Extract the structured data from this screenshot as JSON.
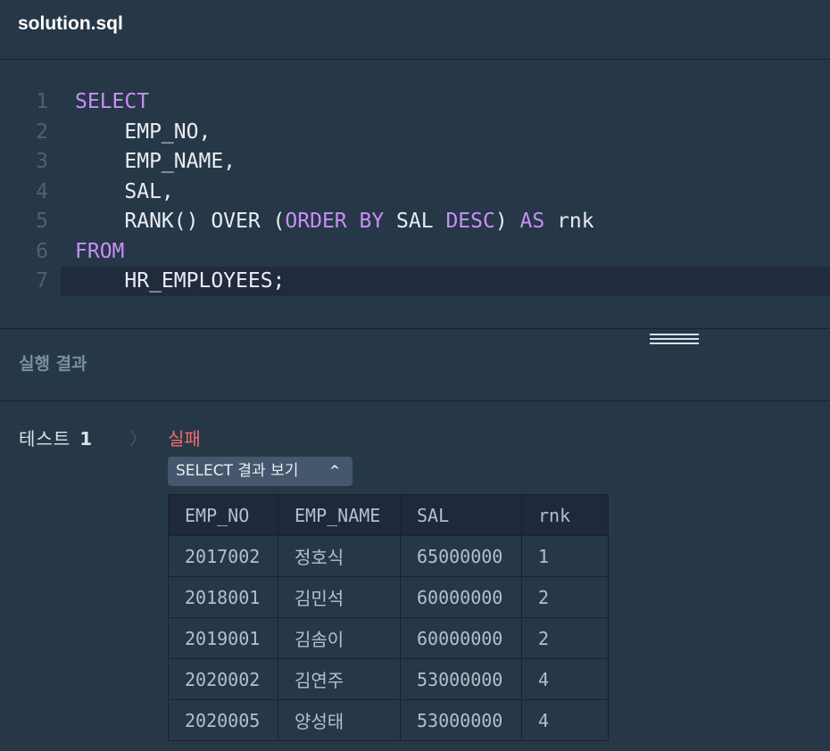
{
  "file": {
    "title": "solution.sql"
  },
  "editor": {
    "lines": [
      {
        "no": "1",
        "tokens": [
          {
            "t": "SELECT",
            "kw": true
          }
        ]
      },
      {
        "no": "2",
        "tokens": [
          {
            "t": "    EMP_NO,",
            "kw": false
          }
        ]
      },
      {
        "no": "3",
        "tokens": [
          {
            "t": "    EMP_NAME,",
            "kw": false
          }
        ]
      },
      {
        "no": "4",
        "tokens": [
          {
            "t": "    SAL,",
            "kw": false
          }
        ]
      },
      {
        "no": "5",
        "tokens": [
          {
            "t": "    RANK() OVER (",
            "kw": false
          },
          {
            "t": "ORDER BY",
            "kw": true
          },
          {
            "t": " SAL ",
            "kw": false
          },
          {
            "t": "DESC",
            "kw": true
          },
          {
            "t": ") ",
            "kw": false
          },
          {
            "t": "AS",
            "kw": true
          },
          {
            "t": " rnk",
            "kw": false
          }
        ]
      },
      {
        "no": "6",
        "tokens": [
          {
            "t": "FROM",
            "kw": true
          }
        ]
      },
      {
        "no": "7",
        "tokens": [
          {
            "t": "    HR_EMPLOYEES;",
            "kw": false
          }
        ],
        "active": true
      }
    ]
  },
  "results": {
    "title": "실행 결과",
    "test_label": "테스트",
    "test_number": "1",
    "chevron": "〉",
    "status": "실패",
    "toggle_label": "SELECT 결과 보기",
    "toggle_caret": "^",
    "columns": [
      "EMP_NO",
      "EMP_NAME",
      "SAL",
      "rnk"
    ],
    "rows": [
      [
        "2017002",
        "정호식",
        "65000000",
        "1"
      ],
      [
        "2018001",
        "김민석",
        "60000000",
        "2"
      ],
      [
        "2019001",
        "김솜이",
        "60000000",
        "2"
      ],
      [
        "2020002",
        "김연주",
        "53000000",
        "4"
      ],
      [
        "2020005",
        "양성태",
        "53000000",
        "4"
      ]
    ]
  },
  "colors": {
    "background": "#263747",
    "keyword": "#c88ff7",
    "fail": "#f06c6c",
    "button": "#44576c"
  }
}
